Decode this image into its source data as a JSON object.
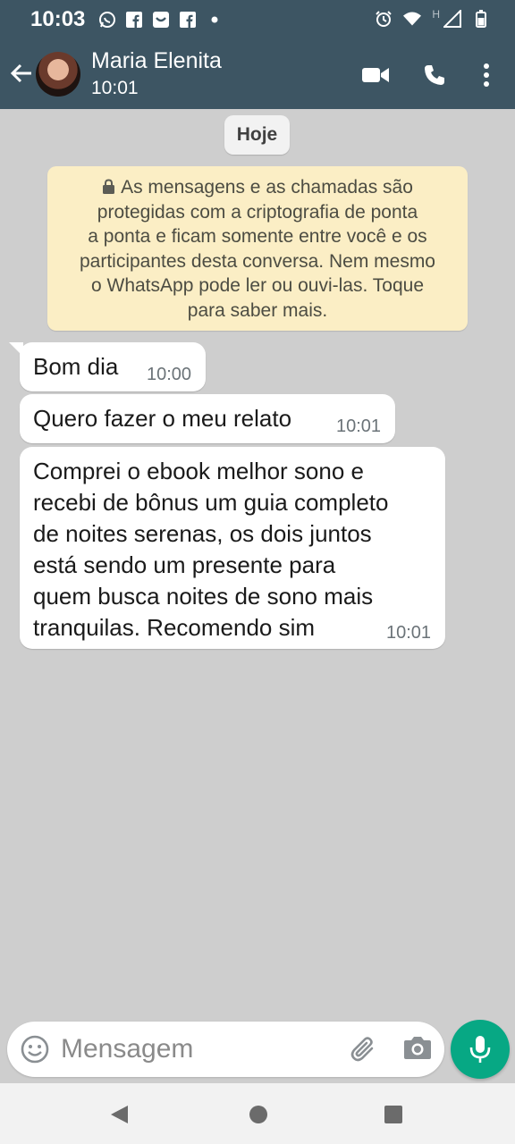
{
  "status_bar": {
    "time": "10:03",
    "left_icons": [
      "whatsapp-icon",
      "facebook-icon",
      "inbox-icon",
      "facebook-icon",
      "dot-icon"
    ],
    "right_icons": [
      "alarm-icon",
      "wifi-icon",
      "h-network-icon",
      "signal-icon",
      "battery-icon"
    ],
    "network_label": "H"
  },
  "header": {
    "contact_name": "Maria Elenita",
    "contact_status": "10:01",
    "icons": [
      "back-arrow-icon",
      "video-call-icon",
      "phone-call-icon",
      "more-options-icon"
    ]
  },
  "chat": {
    "date_chip": "Hoje",
    "encryption_notice": {
      "lines": [
        "As mensagens e as chamadas são",
        "protegidas com a criptografia de ponta",
        "a ponta e ficam somente entre você e os",
        "participantes desta conversa. Nem mesmo",
        "o WhatsApp pode ler ou ouvi-las. Toque",
        "para saber mais."
      ]
    },
    "messages": [
      {
        "lines": [
          "Bom dia"
        ],
        "time": "10:00"
      },
      {
        "lines": [
          "Quero fazer o meu relato"
        ],
        "time": "10:01"
      },
      {
        "lines": [
          "Comprei o ebook melhor sono e",
          "recebi de bônus um guia completo",
          "de noites serenas, os dois juntos",
          "está sendo um presente para",
          "quem busca noites de sono mais",
          "tranquilas. Recomendo sim"
        ],
        "time": "10:01"
      }
    ]
  },
  "composer": {
    "placeholder": "Mensagem",
    "icons": [
      "emoji-icon",
      "attach-icon",
      "camera-icon",
      "mic-icon"
    ]
  },
  "nav": {
    "icons": [
      "back-triangle-icon",
      "home-circle-icon",
      "recents-square-icon"
    ]
  },
  "colors": {
    "header": "#3d5563",
    "chat_bg": "#cecece",
    "notice_bg": "#fbeec5",
    "accent": "#07a884"
  }
}
